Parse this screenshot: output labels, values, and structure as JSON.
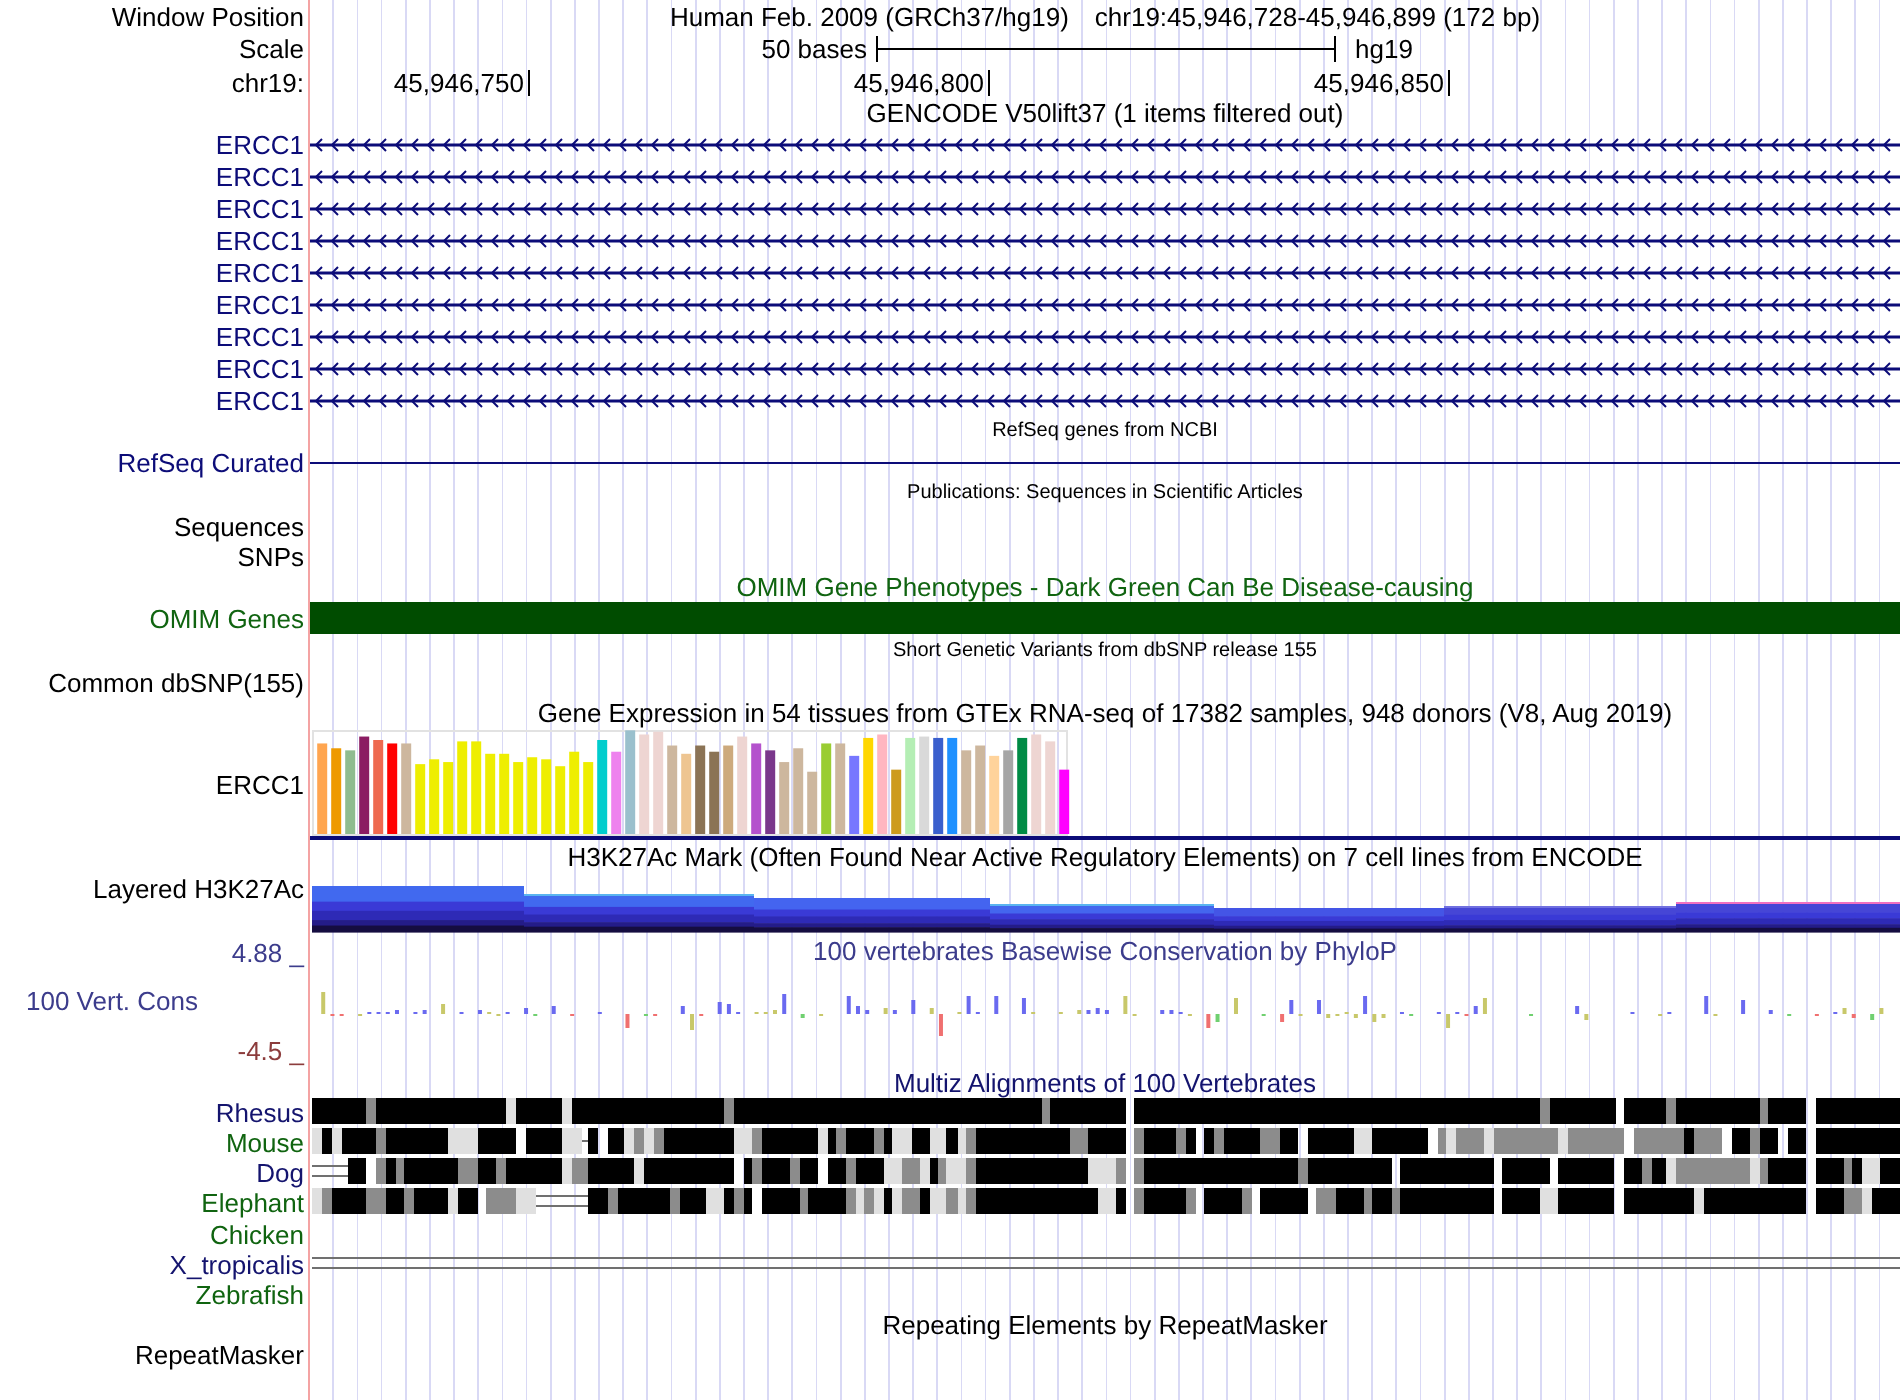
{
  "header": {
    "label": "Window Position",
    "assembly": "Human Feb. 2009 (GRCh37/hg19)",
    "position": "chr19:45,946,728-45,946,899 (172 bp)"
  },
  "scale": {
    "label": "Scale",
    "length": "50 bases",
    "assembly": "hg19"
  },
  "ruler": {
    "label": "chr19:",
    "ticks": [
      "45,946,750",
      "45,946,800",
      "45,946,850"
    ]
  },
  "tracks": [
    {
      "kind": "genes",
      "title": "GENCODE V50lift37 (1 items filtered out)",
      "small_title": false,
      "items": [
        {
          "label": "ERCC1",
          "minus_strand": true
        },
        {
          "label": "ERCC1",
          "minus_strand": true
        },
        {
          "label": "ERCC1",
          "minus_strand": true
        },
        {
          "label": "ERCC1",
          "minus_strand": true
        },
        {
          "label": "ERCC1",
          "minus_strand": true
        },
        {
          "label": "ERCC1",
          "minus_strand": true
        },
        {
          "label": "ERCC1",
          "minus_strand": true
        },
        {
          "label": "ERCC1",
          "minus_strand": true
        },
        {
          "label": "ERCC1",
          "minus_strand": true
        }
      ]
    },
    {
      "kind": "line",
      "title": "RefSeq genes from NCBI",
      "small_title": true,
      "labels": [
        "RefSeq Curated"
      ]
    },
    {
      "kind": "labels",
      "title": "Publications: Sequences in Scientific Articles",
      "small_title": true,
      "labels": [
        "Sequences",
        "SNPs"
      ]
    },
    {
      "kind": "bar",
      "title": "OMIM Gene Phenotypes - Dark Green Can Be Disease-causing",
      "small_title": false,
      "labels": [
        "OMIM Genes"
      ]
    },
    {
      "kind": "empty",
      "title": "Short Genetic Variants from dbSNP release 155",
      "small_title": true,
      "labels": [
        "Common dbSNP(155)"
      ]
    },
    {
      "kind": "expression",
      "title": "Gene Expression in 54 tissues from GTEx RNA-seq of 17382 samples, 948 donors (V8, Aug 2019)",
      "small_title": false,
      "labels": [
        "ERCC1"
      ]
    },
    {
      "kind": "layered",
      "title": "H3K27Ac Mark (Often Found Near Active Regulatory Elements) on 7 cell lines from ENCODE",
      "small_title": false,
      "labels": [
        "Layered H3K27Ac"
      ]
    },
    {
      "kind": "wiggle",
      "title": "100 vertebrates Basewise Conservation by PhyloP",
      "small_title": false,
      "labels": [
        "100 Vert. Cons"
      ],
      "max": "4.88 _",
      "min": "-4.5 _"
    },
    {
      "kind": "multiz",
      "title": "Multiz Alignments of 100 Vertebrates",
      "small_title": false,
      "species": [
        {
          "label": "Rhesus",
          "color": "#14146e"
        },
        {
          "label": "Mouse",
          "color": "#106410"
        },
        {
          "label": "Dog",
          "color": "#14146e"
        },
        {
          "label": "Elephant",
          "color": "#106410"
        },
        {
          "label": "Chicken",
          "color": "#106410"
        },
        {
          "label": "X_tropicalis",
          "color": "#14146e"
        },
        {
          "label": "Zebrafish",
          "color": "#106410"
        }
      ]
    },
    {
      "kind": "repeat",
      "title": "Repeating Elements by RepeatMasker",
      "small_title": false,
      "labels": [
        "RepeatMasker"
      ]
    }
  ]
}
